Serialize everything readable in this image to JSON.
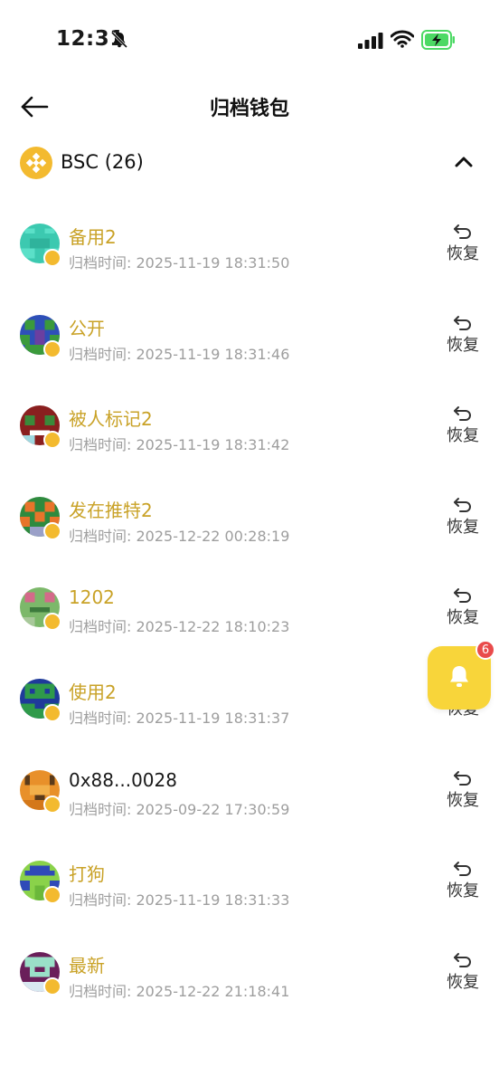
{
  "status_bar": {
    "time": "12:31",
    "icons": [
      "bell-off-icon",
      "signal-icon",
      "wifi-icon",
      "battery-charging-icon"
    ]
  },
  "header": {
    "title": "归档钱包",
    "back_icon": "arrow-left-icon"
  },
  "chain": {
    "name": "BSC (26)",
    "logo_icon": "bnb-logo-icon",
    "toggle_icon": "chevron-up-icon",
    "accent_color": "#f3ba2f"
  },
  "wallets": [
    {
      "name": "备用2",
      "time": "归档时间: 2025-11-19 18:31:50",
      "action": "恢复"
    },
    {
      "name": "公开",
      "time": "归档时间: 2025-11-19 18:31:46",
      "action": "恢复"
    },
    {
      "name": "被人标记2",
      "time": "归档时间: 2025-11-19 18:31:42",
      "action": "恢复"
    },
    {
      "name": "发在推特2",
      "time": "归档时间: 2025-12-22 00:28:19",
      "action": "恢复"
    },
    {
      "name": "1202",
      "time": "归档时间: 2025-12-22 18:10:23",
      "action": "恢复"
    },
    {
      "name": "使用2",
      "time": "归档时间: 2025-11-19 18:31:37",
      "action": "恢复"
    },
    {
      "name": "0x88...0028",
      "time": "归档时间: 2025-09-22 17:30:59",
      "action": "恢复"
    },
    {
      "name": "打狗",
      "time": "归档时间: 2025-11-19 18:31:33",
      "action": "恢复"
    },
    {
      "name": "最新",
      "time": "归档时间: 2025-12-22 21:18:41",
      "action": "恢复"
    }
  ],
  "floating_button": {
    "icon": "bell-icon",
    "badge_count": "6",
    "color": "#f8d53a"
  }
}
